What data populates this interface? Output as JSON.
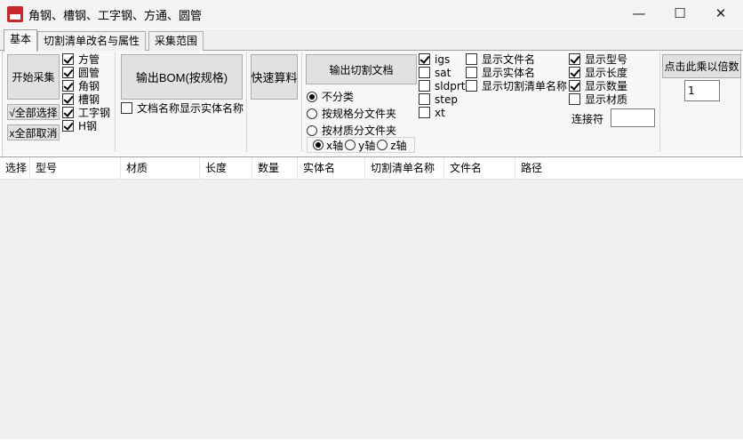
{
  "window": {
    "title": "角钢、槽钢、工字钢、方通、圆管",
    "minimize_glyph": "—",
    "maximize_glyph": "☐",
    "close_glyph": "✕"
  },
  "tabs": [
    {
      "label": "基本",
      "active": true
    },
    {
      "label": "切割清单改名与属性",
      "active": false
    },
    {
      "label": "采集范围",
      "active": false
    }
  ],
  "buttons": {
    "start_collect": "开始采集",
    "select_all": "√全部选择",
    "deselect_all": "x全部取消",
    "export_bom": "输出BOM(按规格)",
    "quick_calc": "快速算料",
    "export_cutlist": "输出切割文档",
    "multiply": "点击此乘以倍数"
  },
  "profile_types": [
    {
      "label": "方管",
      "checked": true
    },
    {
      "label": "圆管",
      "checked": true
    },
    {
      "label": "角钢",
      "checked": true
    },
    {
      "label": "槽钢",
      "checked": true
    },
    {
      "label": "工字钢",
      "checked": true
    },
    {
      "label": "H钢",
      "checked": true
    }
  ],
  "doc_name_option": {
    "label": "文档名称显示实体名称",
    "checked": false
  },
  "classify_options": [
    {
      "label": "不分类",
      "selected": true
    },
    {
      "label": "按规格分文件夹",
      "selected": false
    },
    {
      "label": "按材质分文件夹",
      "selected": false
    }
  ],
  "axis_options": [
    {
      "label": "x轴",
      "selected": true
    },
    {
      "label": "y轴",
      "selected": false
    },
    {
      "label": "z轴",
      "selected": false
    }
  ],
  "export_formats": [
    {
      "label": "igs",
      "checked": true
    },
    {
      "label": "sat",
      "checked": false
    },
    {
      "label": "sldprt",
      "checked": false
    },
    {
      "label": "step",
      "checked": false
    },
    {
      "label": "xt",
      "checked": false
    }
  ],
  "display_options_left": [
    {
      "label": "显示文件名",
      "checked": false
    },
    {
      "label": "显示实体名",
      "checked": false
    },
    {
      "label": "显示切割清单名称",
      "checked": false
    }
  ],
  "display_options_right": [
    {
      "label": "显示型号",
      "checked": true
    },
    {
      "label": "显示长度",
      "checked": true
    },
    {
      "label": "显示数量",
      "checked": true
    },
    {
      "label": "显示材质",
      "checked": false
    }
  ],
  "connector": {
    "label": "连接符",
    "value": ""
  },
  "multiplier": {
    "value": "1"
  },
  "table": {
    "columns": [
      "选择",
      "型号",
      "材质",
      "长度",
      "数量",
      "实体名",
      "切割清单名称",
      "文件名",
      "路径"
    ],
    "rows": []
  }
}
